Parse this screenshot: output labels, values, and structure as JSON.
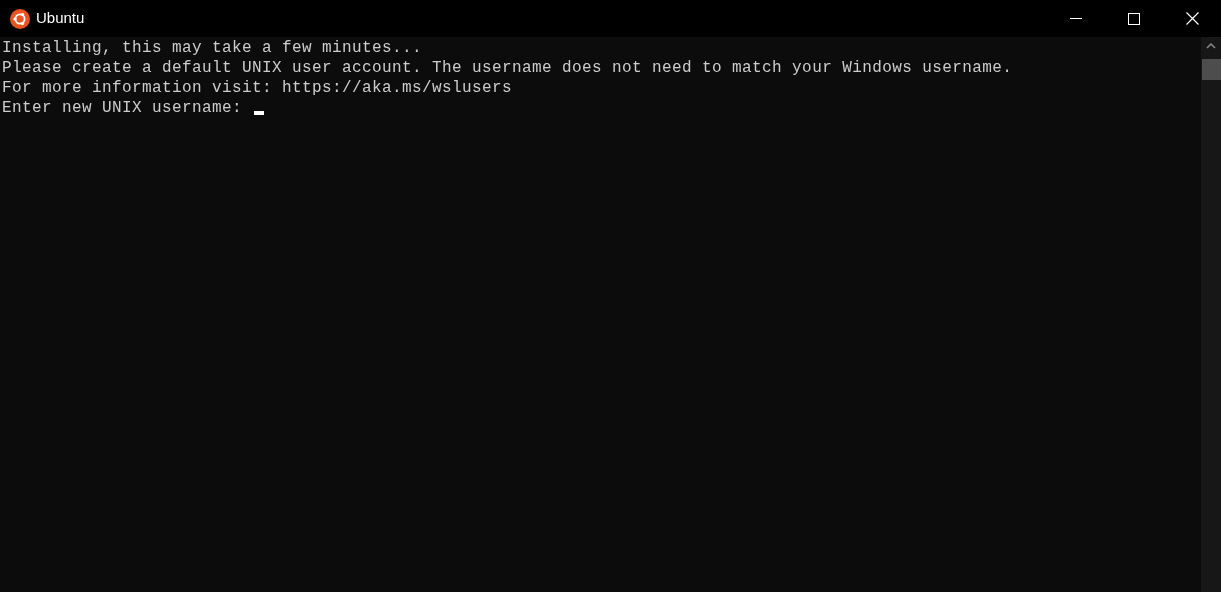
{
  "window": {
    "title": "Ubuntu"
  },
  "terminal": {
    "lines": [
      "Installing, this may take a few minutes...",
      "Please create a default UNIX user account. The username does not need to match your Windows username.",
      "For more information visit: https://aka.ms/wslusers"
    ],
    "prompt": "Enter new UNIX username:"
  }
}
